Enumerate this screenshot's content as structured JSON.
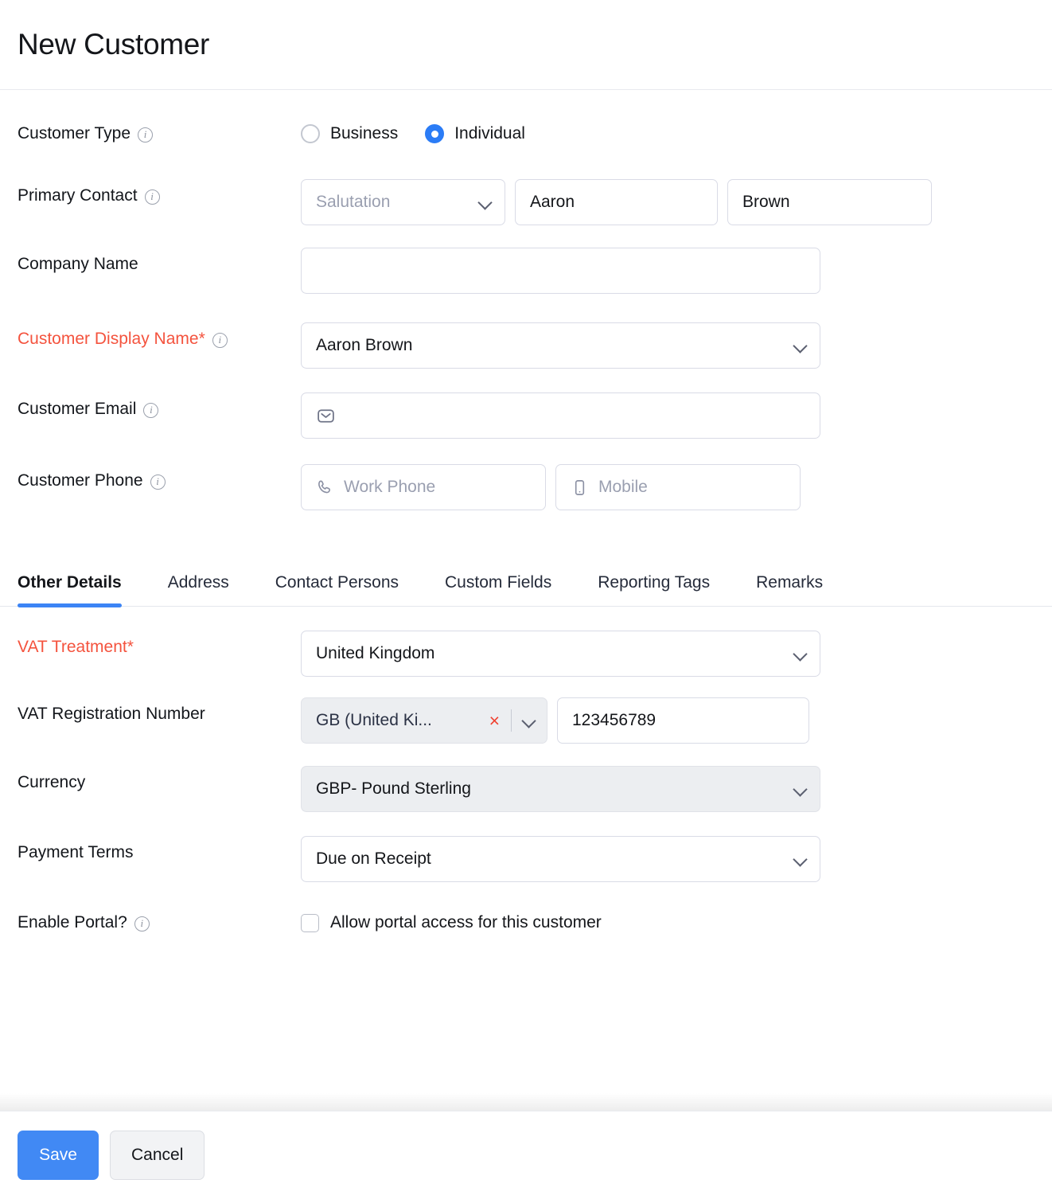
{
  "header": {
    "title": "New Customer"
  },
  "form": {
    "customer_type": {
      "label": "Customer Type",
      "options": [
        {
          "label": "Business",
          "selected": false
        },
        {
          "label": "Individual",
          "selected": true
        }
      ]
    },
    "primary_contact": {
      "label": "Primary Contact",
      "salutation_placeholder": "Salutation",
      "first_name": "Aaron",
      "last_name": "Brown"
    },
    "company_name": {
      "label": "Company Name",
      "value": ""
    },
    "display_name": {
      "label": "Customer Display Name*",
      "value": "Aaron Brown"
    },
    "customer_email": {
      "label": "Customer Email",
      "value": "",
      "icon": "envelope-icon"
    },
    "customer_phone": {
      "label": "Customer Phone",
      "work_placeholder": "Work Phone",
      "mobile_placeholder": "Mobile",
      "work_icon": "phone-icon",
      "mobile_icon": "mobile-icon"
    }
  },
  "tabs": [
    {
      "label": "Other Details",
      "active": true
    },
    {
      "label": "Address",
      "active": false
    },
    {
      "label": "Contact Persons",
      "active": false
    },
    {
      "label": "Custom Fields",
      "active": false
    },
    {
      "label": "Reporting Tags",
      "active": false
    },
    {
      "label": "Remarks",
      "active": false
    }
  ],
  "other_details": {
    "vat_treatment": {
      "label": "VAT Treatment*",
      "value": "United Kingdom"
    },
    "vat_registration": {
      "label": "VAT Registration Number",
      "country_chip": "GB (United Ki...",
      "clear_label": "×",
      "number": "123456789"
    },
    "currency": {
      "label": "Currency",
      "value": "GBP- Pound Sterling"
    },
    "payment_terms": {
      "label": "Payment Terms",
      "value": "Due on Receipt"
    },
    "enable_portal": {
      "label": "Enable Portal?",
      "checkbox_label": "Allow portal access for this customer",
      "checked": false
    }
  },
  "footer": {
    "save": "Save",
    "cancel": "Cancel"
  },
  "colors": {
    "accent": "#4189f4",
    "required": "#f4533e",
    "radio_on": "#2b7cf6",
    "clear_x": "#ef4130",
    "border": "#d9dbe6",
    "disabled_bg": "#eceef1"
  }
}
